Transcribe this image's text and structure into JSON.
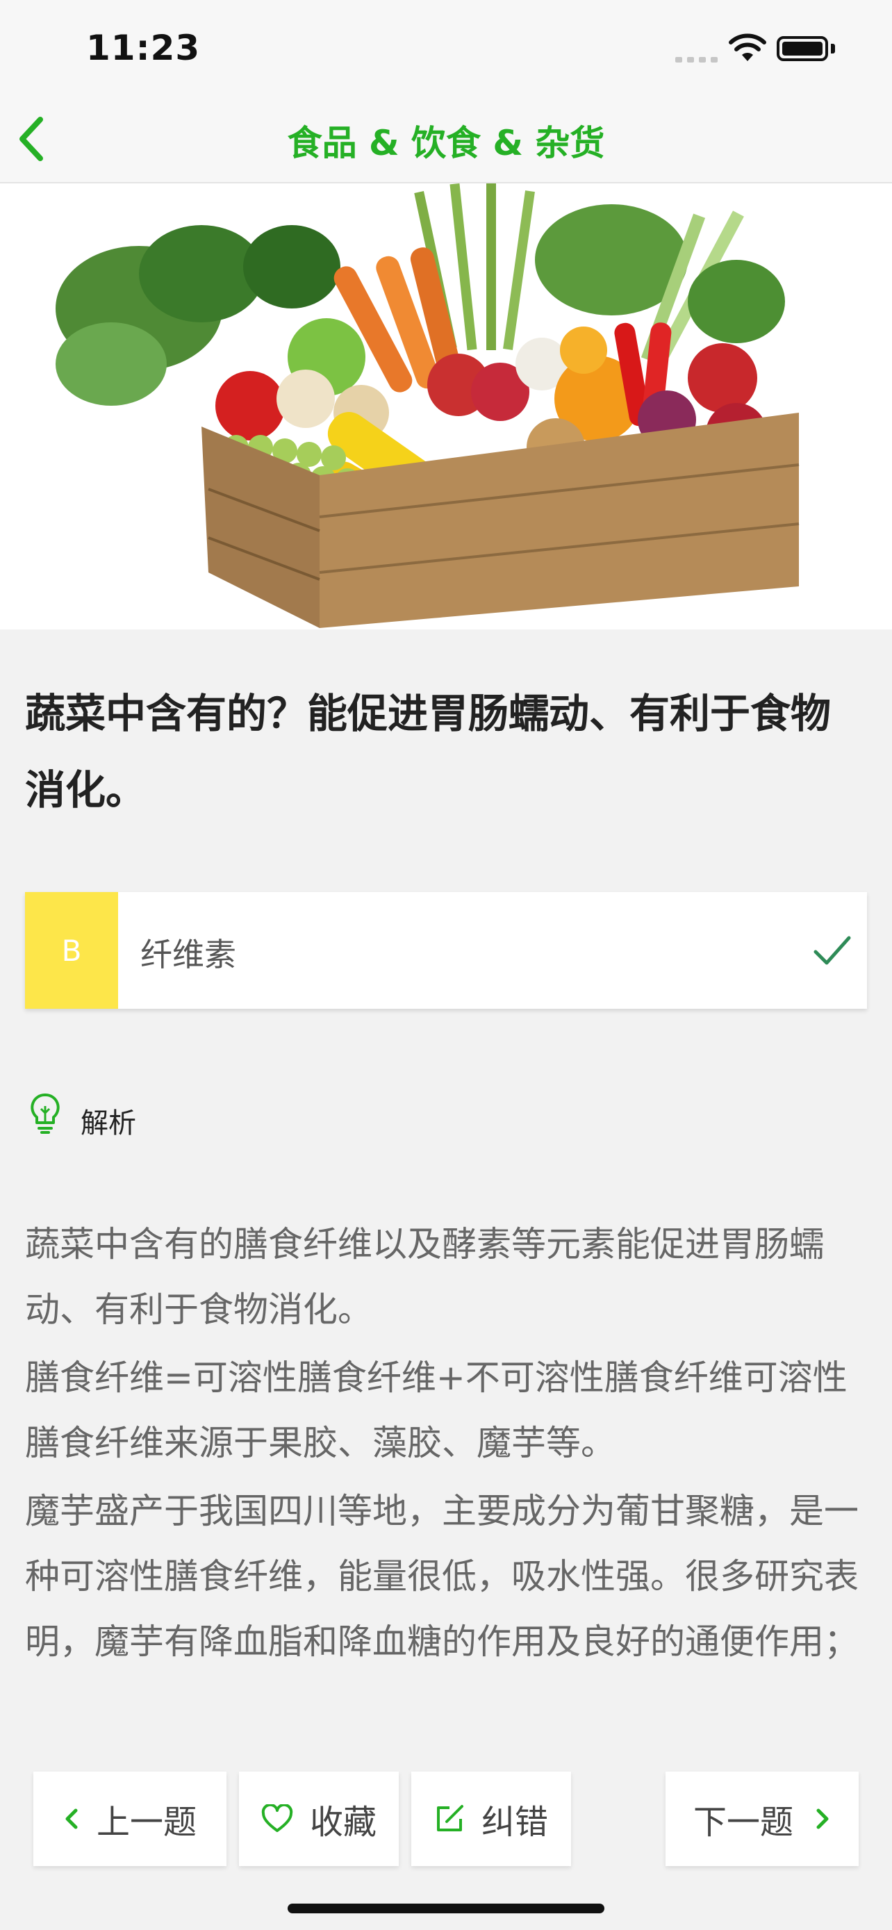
{
  "status_bar": {
    "time": "11:23"
  },
  "nav": {
    "title": "食品 & 饮食 & 杂货"
  },
  "question": {
    "text": "蔬菜中含有的？能促进胃肠蠕动、有利于食物消化。"
  },
  "option": {
    "letter": "B",
    "text": "纤维素",
    "correct": true
  },
  "analysis": {
    "title": "解析",
    "paragraphs": [
      "蔬菜中含有的膳食纤维以及酵素等元素能促进胃肠蠕动、有利于食物消化。",
      "膳食纤维=可溶性膳食纤维+不可溶性膳食纤维可溶性膳食纤维来源于果胶、藻胶、魔芋等。",
      "魔芋盛产于我国四川等地，主要成分为葡甘聚糖，是一种可溶性膳食纤维，能量很低，吸水性强。很多研究表明，魔芋有降血脂和降血糖的作用及良好的通便作用；"
    ]
  },
  "toolbar": {
    "prev_label": "上一题",
    "favorite_label": "收藏",
    "correct_label": "纠错",
    "next_label": "下一题"
  },
  "colors": {
    "accent": "#25b025",
    "option_letter_bg": "#fde64a",
    "check": "#2e8b57"
  },
  "icons": [
    "back-chevron-icon",
    "check-icon",
    "lightbulb-icon",
    "chevron-left-icon",
    "heart-icon",
    "edit-icon",
    "chevron-right-icon",
    "wifi-icon",
    "battery-icon",
    "signal-icon"
  ]
}
